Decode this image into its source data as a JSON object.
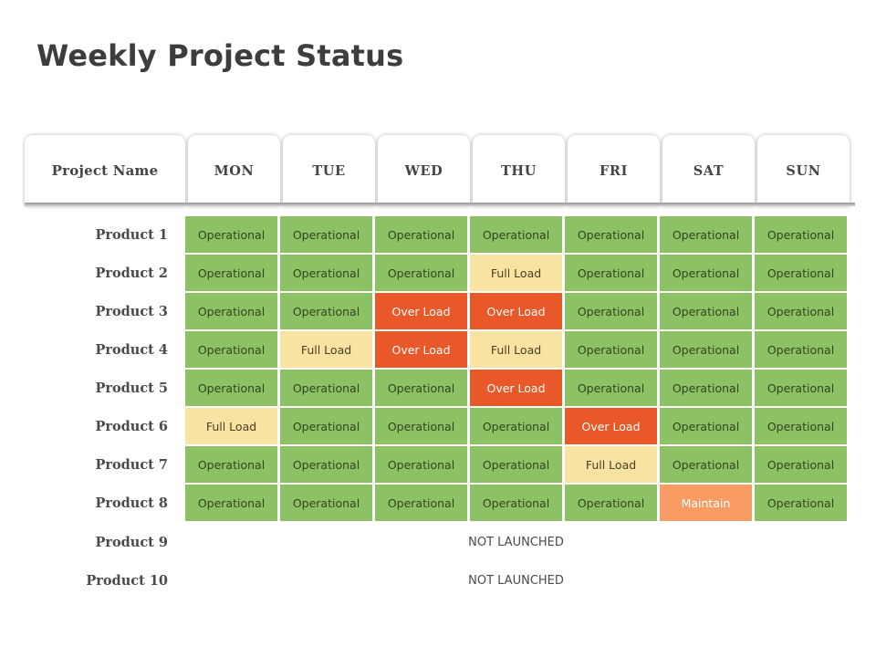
{
  "slide": {
    "title": "Weekly Project Status",
    "background_color": "#ffffff"
  },
  "legend_colors": {
    "operational": "#8cc263",
    "full_load": "#f8e3a2",
    "over_load": "#e85828",
    "maintain": "#f89c63",
    "title_text": "#3d3d3d",
    "label_text": "#4a4a4a"
  },
  "table": {
    "headers": {
      "project_name": "Project Name",
      "days": [
        "MON",
        "TUE",
        "WED",
        "THU",
        "FRI",
        "SAT",
        "SUN"
      ]
    },
    "status_labels": {
      "operational": "Operational",
      "full_load": "Full Load",
      "over_load": "Over Load",
      "maintain": "Maintain",
      "not_launched": "NOT LAUNCHED"
    },
    "rows": [
      {
        "name": "Product 1",
        "cells": [
          {
            "label": "Operational",
            "status": "operational"
          },
          {
            "label": "Operational",
            "status": "operational"
          },
          {
            "label": "Operational",
            "status": "operational"
          },
          {
            "label": "Operational",
            "status": "operational"
          },
          {
            "label": "Operational",
            "status": "operational"
          },
          {
            "label": "Operational",
            "status": "operational"
          },
          {
            "label": "Operational",
            "status": "operational"
          }
        ]
      },
      {
        "name": "Product 2",
        "cells": [
          {
            "label": "Operational",
            "status": "operational"
          },
          {
            "label": "Operational",
            "status": "operational"
          },
          {
            "label": "Operational",
            "status": "operational"
          },
          {
            "label": "Full Load",
            "status": "full-load"
          },
          {
            "label": "Operational",
            "status": "operational"
          },
          {
            "label": "Operational",
            "status": "operational"
          },
          {
            "label": "Operational",
            "status": "operational"
          }
        ]
      },
      {
        "name": "Product 3",
        "cells": [
          {
            "label": "Operational",
            "status": "operational"
          },
          {
            "label": "Operational",
            "status": "operational"
          },
          {
            "label": "Over Load",
            "status": "over-load"
          },
          {
            "label": "Over Load",
            "status": "over-load"
          },
          {
            "label": "Operational",
            "status": "operational"
          },
          {
            "label": "Operational",
            "status": "operational"
          },
          {
            "label": "Operational",
            "status": "operational"
          }
        ]
      },
      {
        "name": "Product 4",
        "cells": [
          {
            "label": "Operational",
            "status": "operational"
          },
          {
            "label": "Full Load",
            "status": "full-load"
          },
          {
            "label": "Over Load",
            "status": "over-load"
          },
          {
            "label": "Full Load",
            "status": "full-load"
          },
          {
            "label": "Operational",
            "status": "operational"
          },
          {
            "label": "Operational",
            "status": "operational"
          },
          {
            "label": "Operational",
            "status": "operational"
          }
        ]
      },
      {
        "name": "Product 5",
        "cells": [
          {
            "label": "Operational",
            "status": "operational"
          },
          {
            "label": "Operational",
            "status": "operational"
          },
          {
            "label": "Operational",
            "status": "operational"
          },
          {
            "label": "Over Load",
            "status": "over-load"
          },
          {
            "label": "Operational",
            "status": "operational"
          },
          {
            "label": "Operational",
            "status": "operational"
          },
          {
            "label": "Operational",
            "status": "operational"
          }
        ]
      },
      {
        "name": "Product 6",
        "cells": [
          {
            "label": "Full Load",
            "status": "full-load"
          },
          {
            "label": "Operational",
            "status": "operational"
          },
          {
            "label": "Operational",
            "status": "operational"
          },
          {
            "label": "Operational",
            "status": "operational"
          },
          {
            "label": "Over Load",
            "status": "over-load"
          },
          {
            "label": "Operational",
            "status": "operational"
          },
          {
            "label": "Operational",
            "status": "operational"
          }
        ]
      },
      {
        "name": "Product 7",
        "cells": [
          {
            "label": "Operational",
            "status": "operational"
          },
          {
            "label": "Operational",
            "status": "operational"
          },
          {
            "label": "Operational",
            "status": "operational"
          },
          {
            "label": "Operational",
            "status": "operational"
          },
          {
            "label": "Full Load",
            "status": "full-load"
          },
          {
            "label": "Operational",
            "status": "operational"
          },
          {
            "label": "Operational",
            "status": "operational"
          }
        ]
      },
      {
        "name": "Product 8",
        "cells": [
          {
            "label": "Operational",
            "status": "operational"
          },
          {
            "label": "Operational",
            "status": "operational"
          },
          {
            "label": "Operational",
            "status": "operational"
          },
          {
            "label": "Operational",
            "status": "operational"
          },
          {
            "label": "Operational",
            "status": "operational"
          },
          {
            "label": "Maintain",
            "status": "maintain"
          },
          {
            "label": "Operational",
            "status": "operational"
          }
        ]
      }
    ],
    "not_launched_rows": [
      {
        "name": "Product 9",
        "text": "NOT LAUNCHED"
      },
      {
        "name": "Product 10",
        "text": "NOT LAUNCHED"
      }
    ]
  }
}
